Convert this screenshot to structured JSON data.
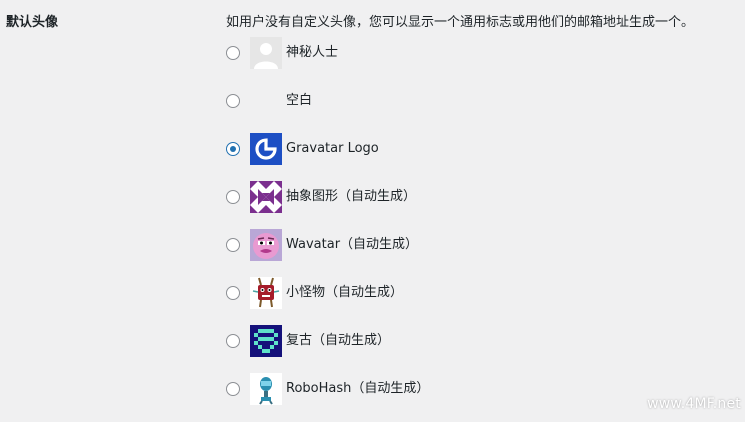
{
  "section": {
    "label": "默认头像",
    "description": "如用户没有自定义头像，您可以显示一个通用标志或用他们的邮箱地址生成一个。"
  },
  "options": [
    {
      "label": "神秘人士",
      "icon": "mystery-person-icon",
      "selected": false
    },
    {
      "label": "空白",
      "icon": "blank-icon",
      "selected": false
    },
    {
      "label": "Gravatar Logo",
      "icon": "gravatar-logo-icon",
      "selected": true
    },
    {
      "label": "抽象图形（自动生成）",
      "icon": "identicon-icon",
      "selected": false
    },
    {
      "label": "Wavatar（自动生成）",
      "icon": "wavatar-icon",
      "selected": false
    },
    {
      "label": "小怪物（自动生成）",
      "icon": "monsterid-icon",
      "selected": false
    },
    {
      "label": "复古（自动生成）",
      "icon": "retro-icon",
      "selected": false
    },
    {
      "label": "RoboHash（自动生成）",
      "icon": "robohash-icon",
      "selected": false
    }
  ],
  "watermark": "www.4MF.net",
  "colors": {
    "background": "#f0f0f1",
    "accent": "#2271b1",
    "text": "#1d2327"
  }
}
